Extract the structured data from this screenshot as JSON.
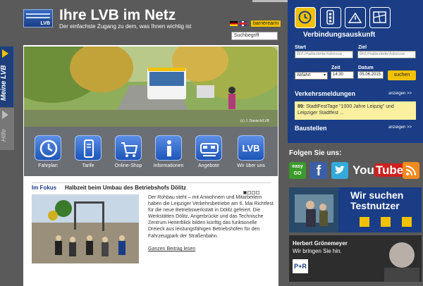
{
  "side_tabs": {
    "meine": "Meine LVB",
    "hilfe": "Hilfe"
  },
  "header": {
    "title": "Ihre LVB im Netz",
    "subtitle": "Der einfachste Zugang zu dem, was Ihnen wichtig ist",
    "logo_text": "LVB",
    "barrierearm": "barrierearm",
    "search_placeholder": "Suchbegriff"
  },
  "hero": {
    "credit": "(c) J. Danisch/LVB"
  },
  "quick_links": [
    {
      "label": "Fahrplan",
      "icon": "clock-icon"
    },
    {
      "label": "Tarife",
      "icon": "ticket-icon"
    },
    {
      "label": "Online-Shop",
      "icon": "cart-icon"
    },
    {
      "label": "Informationen",
      "icon": "info-icon"
    },
    {
      "label": "Angebote",
      "icon": "tram-icon"
    },
    {
      "label": "Wir über uns",
      "icon": "lvb-icon",
      "text": "LVB"
    }
  ],
  "focus": {
    "heading": "Im Fokus",
    "title": "Halbzeit beim Umbau des Betriebshofs Dölitz",
    "body": "Der Rohbau steht – mit Anwohnern und Mitarbeitern haben die Leipziger Verkehrsbetriebe am 6. Mai Richtfest für die neue Betriebswerkstatt in Dölitz gefeiert. Die Werkstätten Dölitz, Angerbrücke und das Technische Zentrum Heiterblick bilden künftig das funktionelle Dreieck aus leistungsfähigen Betriebshöfen für den Fahrzeugpark der Straßenbahn.",
    "more": "Ganzen Beitrag lesen"
  },
  "connection": {
    "title": "Verbindungsauskunft",
    "start_label": "Start",
    "start_placeholder": "Bhf./Haltestelle/Adresse",
    "ziel_label": "Ziel",
    "ziel_placeholder": "Bhf./Haltestelle/Adresse",
    "mode": "Abfahrt",
    "zeit_label": "Zeit",
    "zeit_value": "14:30",
    "datum_label": "Datum",
    "datum_value": "05.06.2015",
    "search_button": "suchen"
  },
  "news": {
    "title": "Verkehrsmeldungen",
    "show": "anzeigen >>",
    "item_number": "89:",
    "item_text": "StadtFestTage \"1000 Jahre Leipzig\" und Leipziger Stadtfest ..."
  },
  "construction": {
    "title": "Baustellen",
    "show": "anzeigen >>"
  },
  "social": {
    "title": "Folgen Sie uns:",
    "easygo": "easy GO",
    "fb": "f",
    "yt_you": "You",
    "yt_tube": "Tube"
  },
  "ad1": {
    "line1": "Wir suchen",
    "line2": "Testnutzer"
  },
  "ad2": {
    "name": "Herbert Grönemeyer",
    "slogan": "Wir bringen Sie hin.",
    "pr": "P+R"
  },
  "colors": {
    "brand_blue": "#1a3d85",
    "accent_yellow": "#f2c200",
    "bg_gray": "#5a5a5a"
  }
}
